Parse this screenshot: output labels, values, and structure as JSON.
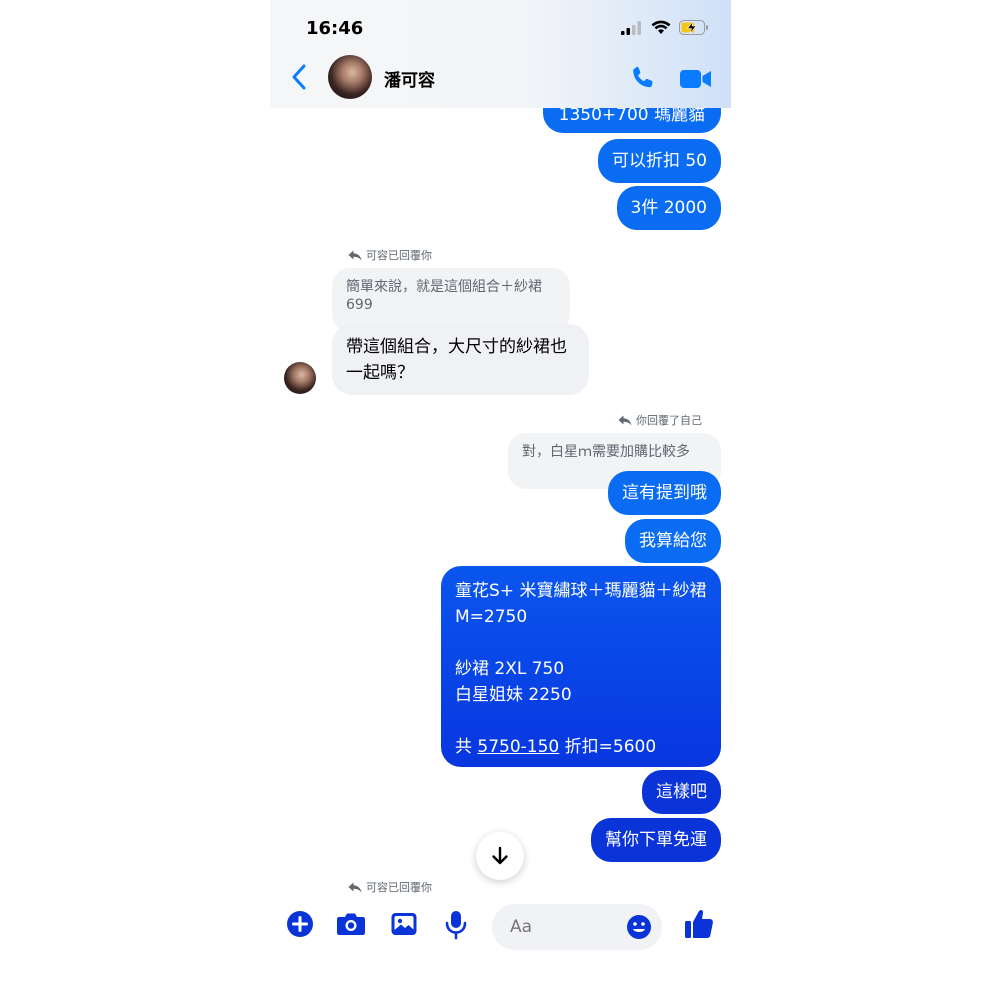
{
  "status_bar": {
    "time": "16:46"
  },
  "header": {
    "contact_name": "潘可容"
  },
  "messages": {
    "m1": "1350+700 瑪麗貓",
    "m2": "可以折扣 50",
    "m3": "3件 2000",
    "reply_note_1": "可容已回覆你",
    "quote_1_line1": "簡單來說，就是這個組合＋紗裙",
    "quote_1_line2": "699",
    "m4_line1": "帶這個組合，大尺寸的紗裙也",
    "m4_line2": "一起嗎？",
    "reply_note_2": "你回覆了自己",
    "quote_2": "對，白星ｍ需要加購比較多",
    "m5": "這有提到哦",
    "m6": "我算給您",
    "m7_line1": "童花S+ 米寶繡球＋瑪麗貓＋紗裙",
    "m7_line2": "M=2750",
    "m7_line3": "紗裙 2XL 750",
    "m7_line4": "白星姐妹 2250",
    "m7_line5_prefix": "共 ",
    "m7_line5_link": "5750-150",
    "m7_line5_suffix": " 折扣=5600",
    "m8": "這樣吧",
    "m9": "幫你下單免運",
    "reply_note_3": "可容已回覆你"
  },
  "composer": {
    "placeholder": "Aa"
  },
  "icons": {
    "accent": "#0a6cf2",
    "deep": "#0a34d8"
  }
}
